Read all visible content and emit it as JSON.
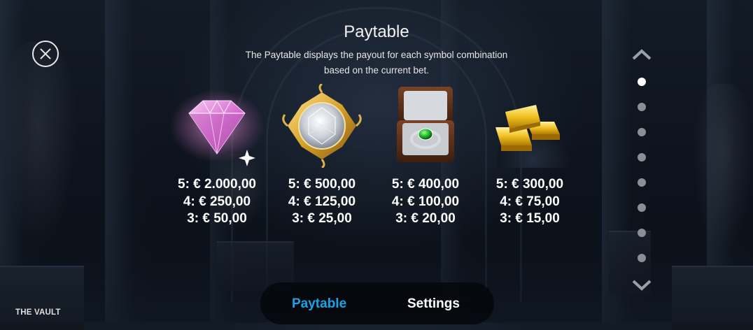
{
  "dialog": {
    "title": "Paytable",
    "description_line1": "The Paytable displays the payout for each symbol combination",
    "description_line2": "based on the current bet.",
    "close_icon": "close-circle-icon"
  },
  "symbols": [
    {
      "icon": "pink-diamond-icon",
      "payouts": [
        "5: € 2.000,00",
        "4: € 250,00",
        "3: € 50,00"
      ]
    },
    {
      "icon": "gold-framed-diamond-icon",
      "payouts": [
        "5: € 500,00",
        "4: € 125,00",
        "3: € 25,00"
      ]
    },
    {
      "icon": "emerald-ring-box-icon",
      "payouts": [
        "5: € 400,00",
        "4: € 100,00",
        "3: € 20,00"
      ]
    },
    {
      "icon": "gold-bars-icon",
      "payouts": [
        "5: € 300,00",
        "4: € 75,00",
        "3: € 15,00"
      ]
    }
  ],
  "pagination": {
    "up_icon": "chevron-up-icon",
    "down_icon": "chevron-down-icon",
    "page_count": 8,
    "active_page": 1
  },
  "tabs": {
    "paytable": "Paytable",
    "settings": "Settings",
    "active": "Paytable"
  },
  "brand": "THE VAULT",
  "colors": {
    "accent": "#1aa3e8",
    "text": "#ffffff",
    "dot_inactive": "#8a8e95"
  }
}
